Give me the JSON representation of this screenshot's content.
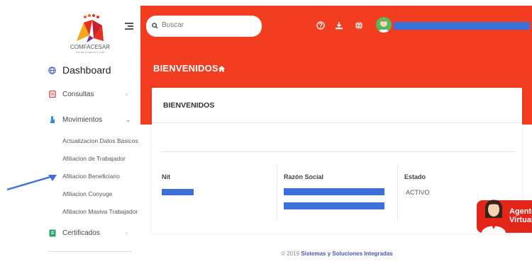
{
  "sidebar": {
    "logo_text": "COMFACESAR",
    "logo_subtitle": "Somos progreso y vida",
    "items": [
      {
        "label": "Dashboard",
        "icon": "globe-icon"
      },
      {
        "label": "Consultas",
        "icon": "document-icon"
      },
      {
        "label": "Movimientos",
        "icon": "hand-icon"
      },
      {
        "label": "Certificados",
        "icon": "certificate-icon"
      }
    ],
    "submenu": [
      "Actualizacion Datos Basicos",
      "Afiliacion de Trabajador",
      "Afiliacion Beneficiario",
      "Afiliacion Conyuge",
      "Afiliacion Masiva Trabajador"
    ]
  },
  "header": {
    "search_placeholder": "Buscar",
    "icons": [
      "help-icon",
      "download-icon",
      "language-icon"
    ]
  },
  "main": {
    "page_title": "BIENVENIDOS",
    "card_title": "BIENVENIDOS",
    "columns": [
      "Nit",
      "Razón Social",
      "Estado"
    ],
    "estado_value": "ACTIVO"
  },
  "footer": {
    "prefix": "© 2019",
    "brand": "Sistemas y Soluciones Integradas"
  },
  "agent": {
    "line1": "Agente",
    "line2": "Virtual"
  },
  "colors": {
    "brand_red": "#f23d20",
    "redaction_blue": "#3d6fd8",
    "accent_link": "#4a55c4"
  }
}
